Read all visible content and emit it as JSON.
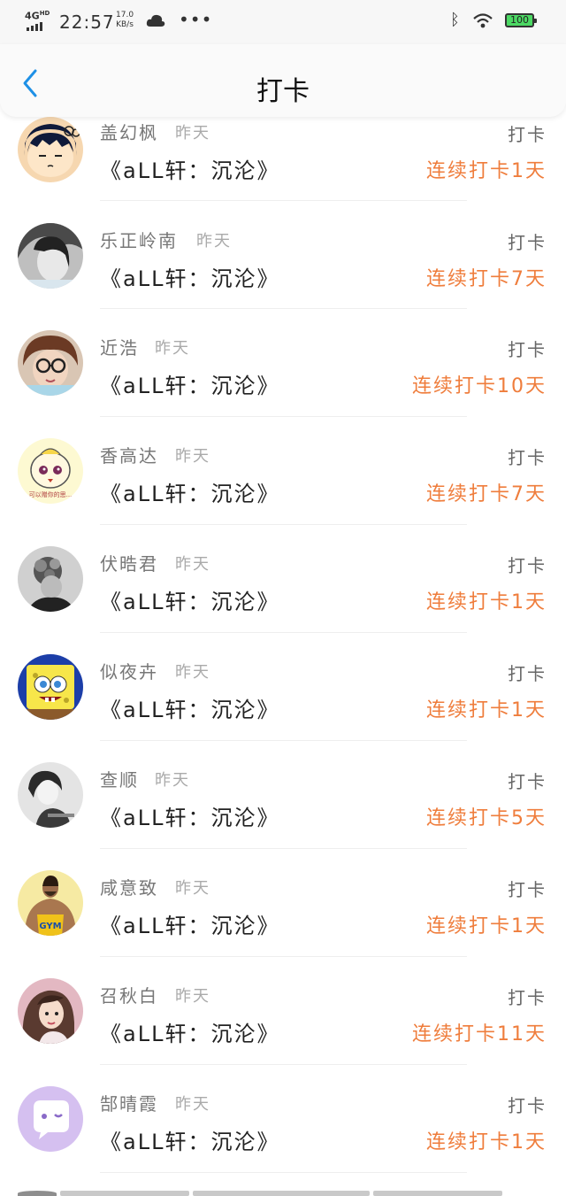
{
  "status_bar": {
    "network": "4G",
    "network_sup": "HD",
    "time": "22:57",
    "speed_value": "17.0",
    "speed_unit": "KB/s",
    "battery": "100",
    "icons": [
      "signal-icon",
      "cloud-icon",
      "more-dots-icon",
      "bluetooth-icon",
      "wifi-icon",
      "battery-icon"
    ]
  },
  "header": {
    "title": "打卡",
    "back_icon": "chevron-left-icon"
  },
  "list": [
    {
      "name": "盖幻枫",
      "when": "昨天",
      "book": "《aLL轩：沉沦》",
      "action": "打卡",
      "streak": "连续打卡1天",
      "avatar": "cartoon-girl"
    },
    {
      "name": "乐正岭南",
      "when": "昨天",
      "book": "《aLL轩：沉沦》",
      "action": "打卡",
      "streak": "连续打卡7天",
      "avatar": "bw-portrait"
    },
    {
      "name": "近浩",
      "when": "昨天",
      "book": "《aLL轩：沉沦》",
      "action": "打卡",
      "streak": "连续打卡10天",
      "avatar": "glasses-girl"
    },
    {
      "name": "香高达",
      "when": "昨天",
      "book": "《aLL轩：沉沦》",
      "action": "打卡",
      "streak": "连续打卡7天",
      "avatar": "cute-character"
    },
    {
      "name": "伏晧君",
      "when": "昨天",
      "book": "《aLL轩：沉沦》",
      "action": "打卡",
      "streak": "连续打卡1天",
      "avatar": "bw-flower"
    },
    {
      "name": "似夜卉",
      "when": "昨天",
      "book": "《aLL轩：沉沦》",
      "action": "打卡",
      "streak": "连续打卡1天",
      "avatar": "sponge-cartoon"
    },
    {
      "name": "查顺",
      "when": "昨天",
      "book": "《aLL轩：沉沦》",
      "action": "打卡",
      "streak": "连续打卡5天",
      "avatar": "bw-girl"
    },
    {
      "name": "咸意致",
      "when": "昨天",
      "book": "《aLL轩：沉沦》",
      "action": "打卡",
      "streak": "连续打卡1天",
      "avatar": "gym-man"
    },
    {
      "name": "召秋白",
      "when": "昨天",
      "book": "《aLL轩：沉沦》",
      "action": "打卡",
      "streak": "连续打卡11天",
      "avatar": "pink-girl"
    },
    {
      "name": "郜晴霞",
      "when": "昨天",
      "book": "《aLL轩：沉沦》",
      "action": "打卡",
      "streak": "连续打卡1天",
      "avatar": "chat-bubble"
    }
  ],
  "colors": {
    "streak": "#ef7d3c",
    "accent_back": "#1e90e6",
    "name": "#777777"
  }
}
